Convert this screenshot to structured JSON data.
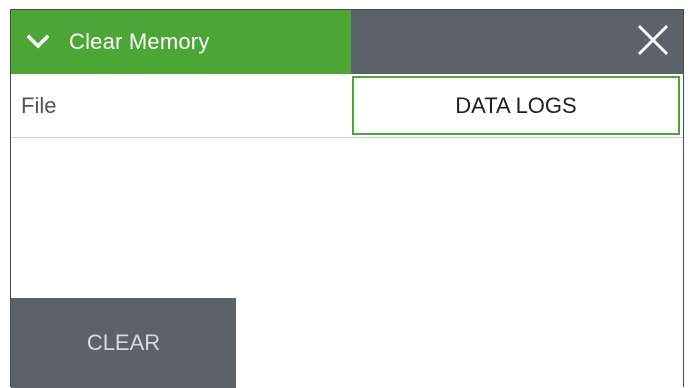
{
  "header": {
    "title": "Clear Memory",
    "accent_color": "#4ca535",
    "dark_color": "#5b626a",
    "collapse_icon": "chevron-down-icon",
    "close_icon": "close-icon"
  },
  "file_row": {
    "label": "File",
    "selected_value": "DATA LOGS"
  },
  "actions": {
    "clear_label": "CLEAR"
  }
}
